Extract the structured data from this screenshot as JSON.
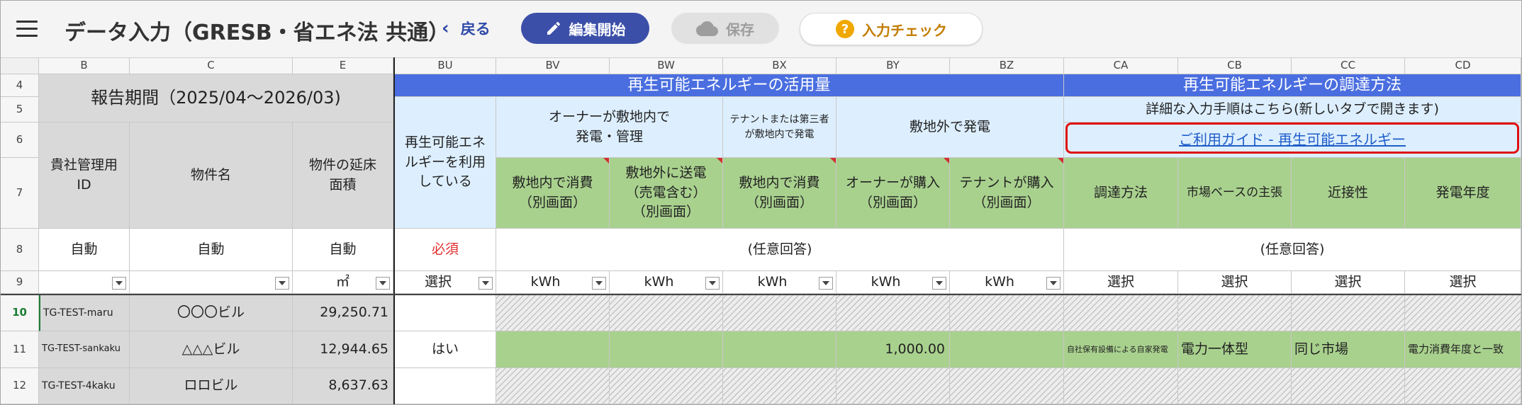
{
  "toolbar": {
    "title": "データ入力（GRESB・省エネ法 共通）",
    "back_label": "戻る",
    "edit_label": "編集開始",
    "save_label": "保存",
    "check_label": "入力チェック"
  },
  "columns": [
    "B",
    "C",
    "E",
    "BU",
    "BV",
    "BW",
    "BX",
    "BY",
    "BZ",
    "CA",
    "CB",
    "CC",
    "CD"
  ],
  "rows": [
    "4",
    "5",
    "6",
    "7",
    "8",
    "9",
    "10",
    "11",
    "12"
  ],
  "header": {
    "period": "報告期間（2025/04〜2026/03)",
    "id_label": "貴社管理用ID",
    "name_label": "物件名",
    "area_label": "物件の延床面積",
    "re_use_label": "再生可能エネルギーを利用している",
    "usage_title": "再生可能エネルギーの活用量",
    "owner_onsite": "オーナーが敷地内で発電・管理",
    "tenant_onsite": "テナントまたは第三者が敷地内で発電",
    "offsite": "敷地外で発電",
    "procure_title": "再生可能エネルギーの調達方法",
    "detail_note": "詳細な入力手順はこちら(新しいタブで開きます)",
    "guide_link": "ご利用ガイド - 再生可能エネルギー",
    "sub_bv": "敷地内で消費（別画面）",
    "sub_bw": "敷地外に送電（売電含む）（別画面）",
    "sub_bx": "敷地内で消費（別画面）",
    "sub_by": "オーナーが購入（別画面）",
    "sub_bz": "テナントが購入（別画面）",
    "sub_ca": "調達方法",
    "sub_cb": "市場ベースの主張",
    "sub_cc": "近接性",
    "sub_cd": "発電年度",
    "auto": "自動",
    "required": "必須",
    "optional": "(任意回答)",
    "unit_area": "㎡",
    "unit_select": "選択",
    "unit_kwh": "kWh"
  },
  "data_rows": [
    {
      "id": "TG-TEST-maru",
      "name": "〇〇〇ビル",
      "area": "29,250.71",
      "re": "",
      "by": "",
      "ca": "",
      "cb": "",
      "cc": "",
      "cd": ""
    },
    {
      "id": "TG-TEST-sankaku",
      "name": "△△△ビル",
      "area": "12,944.65",
      "re": "はい",
      "by": "1,000.00",
      "ca": "自社保有設備による自家発電",
      "cb": "電力一体型",
      "cc": "同じ市場",
      "cd": "電力消費年度と一致"
    },
    {
      "id": "TG-TEST-4kaku",
      "name": "ロロビル",
      "area": "8,637.63",
      "re": "",
      "by": "",
      "ca": "",
      "cb": "",
      "cc": "",
      "cd": ""
    }
  ],
  "colors": {
    "accent": "#3b4fa9",
    "header_blue": "#4a6ee0",
    "input_green": "#a9d18e",
    "light_blue": "#ddefff",
    "required_red": "#e03030"
  }
}
